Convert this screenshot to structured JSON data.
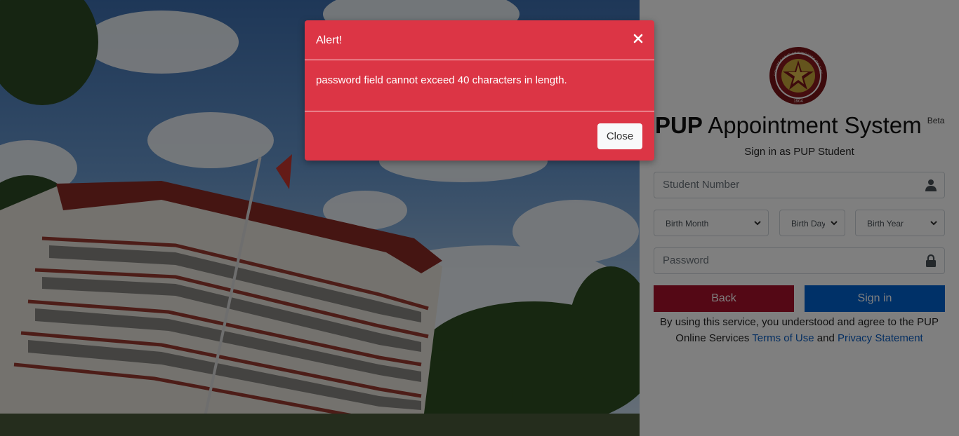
{
  "hero": {
    "image": "pup-main-building-photo"
  },
  "panel": {
    "logo": "pup-seal-logo",
    "seal_text": "POLYTECHNIC UNIVERSITY OF THE PHILIPPINES",
    "seal_year": "1904",
    "title_bold": "PUP",
    "title_rest": " Appointment System",
    "title_badge": "Beta",
    "subtitle": "Sign in as PUP Student",
    "student_number": {
      "placeholder": "Student Number",
      "icon": "user-icon"
    },
    "birth_month": {
      "selected": "Birth Month"
    },
    "birth_day": {
      "selected": "Birth Day"
    },
    "birth_year": {
      "selected": "Birth Year"
    },
    "password": {
      "placeholder": "Password",
      "icon": "lock-icon"
    },
    "back_label": "Back",
    "signin_label": "Sign in",
    "terms_prefix": "By using this service, you understood and agree to the PUP Online Services ",
    "terms_link": "Terms of Use",
    "terms_and": " and ",
    "privacy_link": "Privacy Statement"
  },
  "modal": {
    "title": "Alert!",
    "close_icon": "close-icon",
    "message": "password field cannot exceed 40 characters in length.",
    "close_label": "Close"
  },
  "colors": {
    "modal_bg": "#dc3545",
    "back_button": "#a8102b",
    "signin_button": "#0063d1",
    "link": "#0a5ec4"
  }
}
